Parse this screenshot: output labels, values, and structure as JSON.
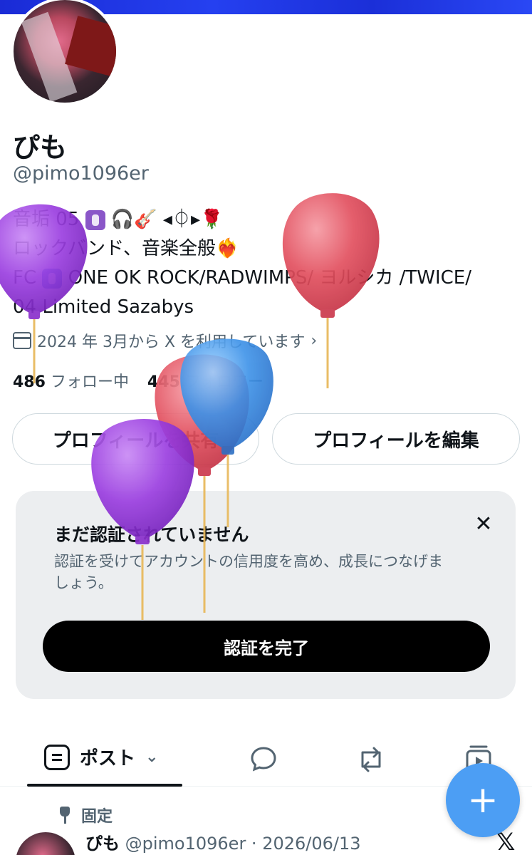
{
  "profile": {
    "name": "ぴも",
    "handle": "@pimo1096er",
    "bio": {
      "line1": "音垢 05",
      "line1_end": "🎧🎸 ◂⏀▸🌹",
      "line2": "ロックバンド、音楽全般❤️‍🔥",
      "line3_prefix": "FC",
      "line3": "ONE OK ROCK/RADWIMPS/ ヨルシカ /TWICE/",
      "line4": "04 Limited Sazabys"
    },
    "joined": "2024 年 3月から X を利用しています",
    "following_count": "486",
    "following_label": "フォロー中",
    "followers_count": "445",
    "followers_label": "フォロワー"
  },
  "buttons": {
    "share_label": "プロフィールを共有",
    "edit_label": "プロフィールを編集"
  },
  "verify": {
    "title": "まだ認証されていません",
    "description": "認証を受けてアカウントの信用度を高め、成長につなげましょう。",
    "button_label": "認証を完了"
  },
  "tabs": {
    "post_label": "ポスト"
  },
  "pinned": {
    "label": "固定",
    "author": "ぴも",
    "meta": " @pimo1096er · 2026/06/13"
  },
  "colors": {
    "banner": "#2540f0",
    "fab": "#4c9ef4",
    "balloon_purple": "#9b3fe0",
    "balloon_red": "#e2505f",
    "balloon_blue": "#3d92e8"
  }
}
